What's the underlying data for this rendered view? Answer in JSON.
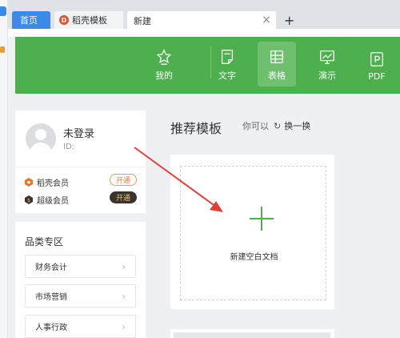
{
  "tabs": [
    {
      "label": "首页"
    },
    {
      "label": "稻壳模板",
      "icon": "docer-logo-icon"
    },
    {
      "label": "新建"
    }
  ],
  "tab_close": "×",
  "add_tab": "+",
  "toolbar": {
    "items": [
      {
        "label": "我的",
        "icon": "star-icon",
        "active": false
      },
      {
        "label": "文字",
        "icon": "document-icon",
        "active": false
      },
      {
        "label": "表格",
        "icon": "table-icon",
        "active": true
      },
      {
        "label": "演示",
        "icon": "presentation-icon",
        "active": false
      },
      {
        "label": "PDF",
        "icon": "pdf-icon",
        "active": false
      }
    ]
  },
  "profile": {
    "name": "未登录",
    "id_label": "ID:",
    "memberships": [
      {
        "label": "稻壳会员",
        "button": "开通",
        "color": "#e8742e"
      },
      {
        "label": "超级会员",
        "button": "开通",
        "color": "#3a3430"
      }
    ]
  },
  "categories": {
    "title": "品类专区",
    "items": [
      {
        "label": "财务会计"
      },
      {
        "label": "市场营销"
      },
      {
        "label": "人事行政"
      }
    ]
  },
  "recommended": {
    "title": "推荐模板",
    "hint": "你可以",
    "refresh_label": "换一换"
  },
  "new_blank": {
    "label": "新建空白文档"
  },
  "colors": {
    "accent_green": "#4daf4d",
    "tab_blue": "#3c8ae8",
    "arrow_red": "#e0403a"
  }
}
